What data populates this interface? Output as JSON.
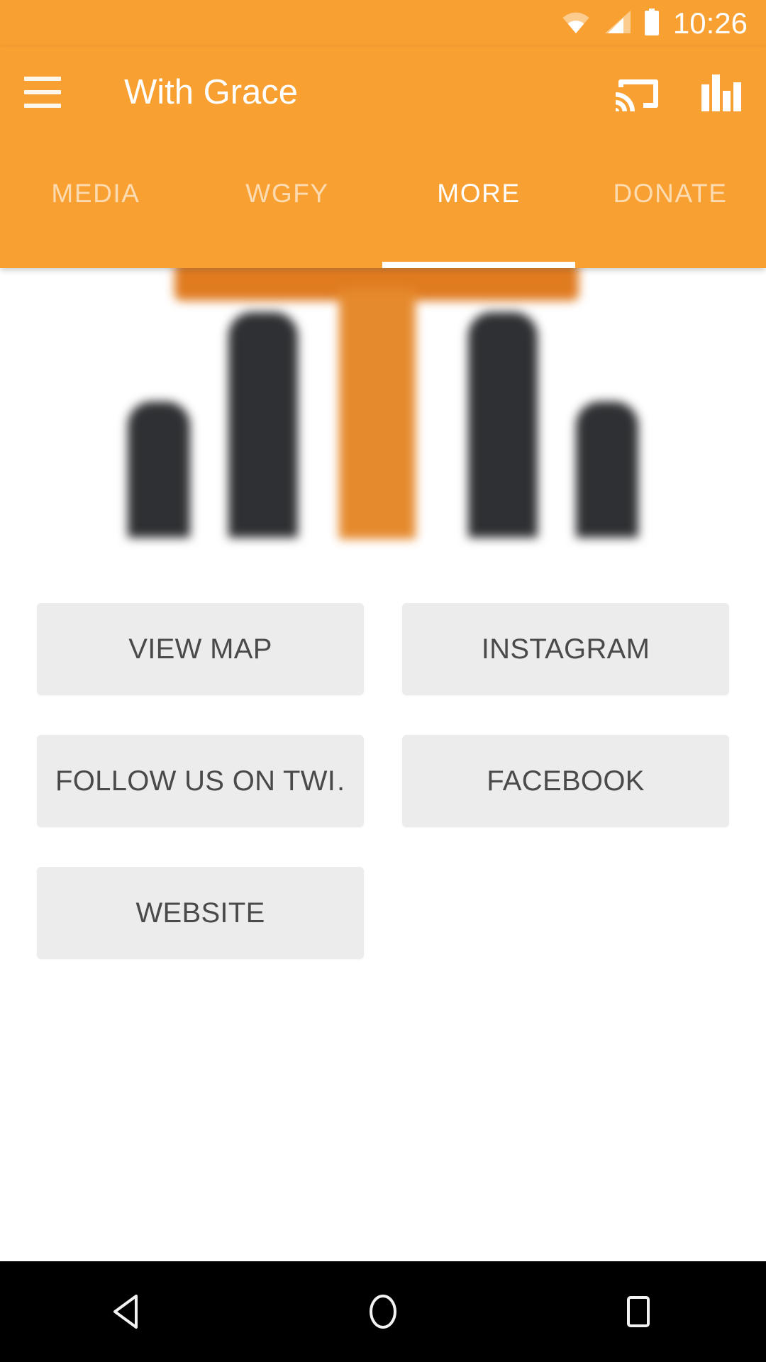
{
  "status_bar": {
    "time": "10:26",
    "icons": [
      "wifi-icon",
      "cellular-signal-icon",
      "battery-icon"
    ]
  },
  "app_bar": {
    "title": "With Grace",
    "menu_icon": "hamburger-menu-icon",
    "actions": [
      {
        "name": "cast-icon",
        "label": "Cast"
      },
      {
        "name": "equalizer-icon",
        "label": "Equalizer"
      }
    ]
  },
  "tabs": [
    {
      "label": "MEDIA",
      "active": false
    },
    {
      "label": "WGFY",
      "active": false
    },
    {
      "label": "MORE",
      "active": true
    },
    {
      "label": "DONATE",
      "active": false
    }
  ],
  "hero": {
    "description": "blurred app logo"
  },
  "buttons": [
    {
      "label": "VIEW MAP"
    },
    {
      "label": "INSTAGRAM"
    },
    {
      "label": "FOLLOW US ON TWI…"
    },
    {
      "label": "FACEBOOK"
    },
    {
      "label": "WEBSITE"
    }
  ],
  "nav_bar": {
    "back": "back-icon",
    "home": "home-icon",
    "recents": "recents-icon"
  },
  "colors": {
    "accent": "#F9A032",
    "tile": "#ececec",
    "tile_text": "#4a4a4a",
    "nav_bar": "#000000"
  }
}
